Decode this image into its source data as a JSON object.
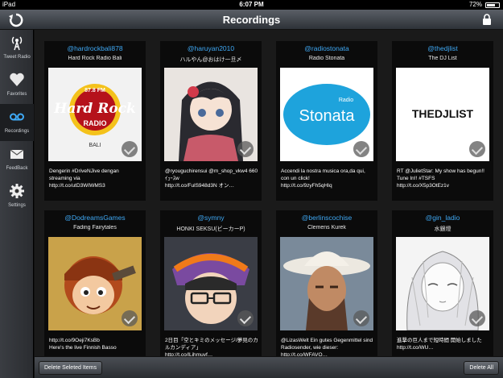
{
  "status_bar": {
    "device": "iPad",
    "time": "6:07 PM",
    "battery": "72%",
    "battery_level": 0.72
  },
  "nav": {
    "title": "Recordings"
  },
  "sidebar": {
    "items": [
      {
        "label": "Tweet Radio",
        "icon": "radio-tower-icon"
      },
      {
        "label": "Favorites",
        "icon": "heart-icon"
      },
      {
        "label": "Recordings",
        "icon": "cassette-icon"
      },
      {
        "label": "FeedBack",
        "icon": "envelope-icon"
      },
      {
        "label": "Settings",
        "icon": "gear-icon"
      }
    ]
  },
  "tiles": [
    {
      "handle": "@hardrockbali878",
      "name": "Hard Rock Radio Bali",
      "tweet": "Dengerin #DriveNJive dengan streaming via\nhttp://t.co/utD3WIWMS3",
      "logo_text": "Hard Rock",
      "logo_top": "87.8 FM",
      "logo_sub": "RADIO",
      "logo_city": "BALI"
    },
    {
      "handle": "@haruyan2010",
      "name": "ハルやん@おはけ一旦〆",
      "tweet": "@ryouguchirensui @m_shop_vkw4 660 ｲｭｰｽw\nhttp://t.co/FulS948d3N  オン…"
    },
    {
      "handle": "@radiostonata",
      "name": "Radio Stonata",
      "tweet": "Accendi la nostra musica ora,da qui, con un click!\nhttp://t.co/9zyFh5qHIq",
      "logo_text": "Stonata",
      "logo_sub": "Radio"
    },
    {
      "handle": "@thedjlist",
      "name": "The DJ List",
      "tweet": "RT @JulietStar: My show has begun!! Tune In!! #TSFS\nhttp://t.co/X5p3OtEz1v",
      "logo_text": "THEDJLIST"
    },
    {
      "handle": "@DodreamsGames",
      "name": "Fading Fairytales",
      "tweet": "http://t.co/9Oeji7KsBb\nHere's the live Finnish Basso"
    },
    {
      "handle": "@symny",
      "name": "HONKI SEKSU(ビーカーP)",
      "tweet": "2日目「空とキミのメッセージ/夢見のカルカンディア」\nhttp://t.co/lLihmuvf…"
    },
    {
      "handle": "@berlinscochise",
      "name": "Clemens Kurek",
      "tweet": "@LizasWelt Ein gutes Gegenmittel sind Radiosender, wie dieser: http://t.co/WFAVO…"
    },
    {
      "handle": "@gin_ladio",
      "name": "水銀燈",
      "tweet": "進撃の巨人まで短時間 開始しました\nhttp://t.co/WU…"
    }
  ],
  "toolbar": {
    "delete_selected": "Delete Seleted Items",
    "delete_all": "Delete All"
  },
  "colors": {
    "accent": "#3fa9f5",
    "nav_top": "#5a5f66",
    "nav_bottom": "#2e3238"
  }
}
